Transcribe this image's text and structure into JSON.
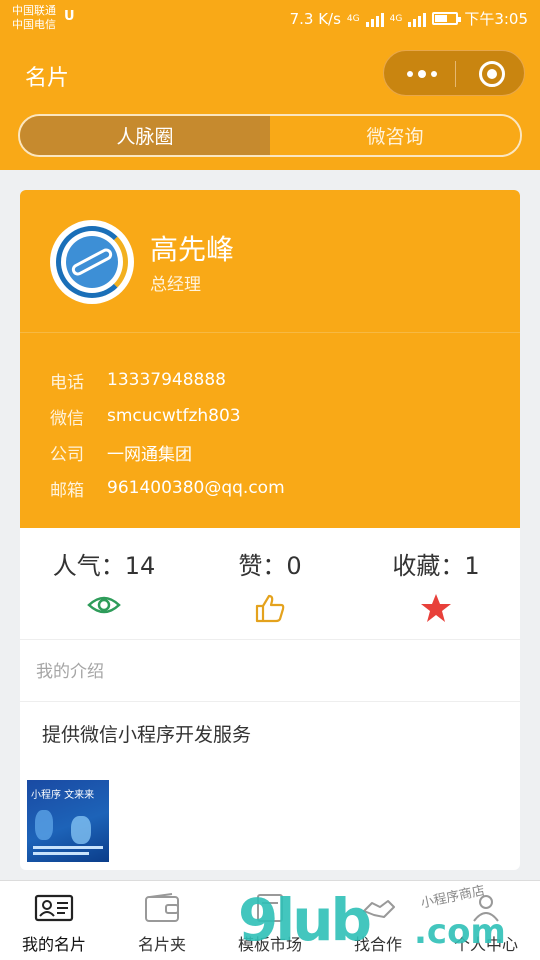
{
  "status_bar": {
    "carrier_1": "中国联通",
    "carrier_2": "中国电信",
    "speed": "7.3 K/s",
    "net_1": "4G",
    "net_2": "4G",
    "time": "下午3:05"
  },
  "nav": {
    "title": "名片",
    "more_icon": "more-dots-icon",
    "close_icon": "target-icon"
  },
  "segments": [
    {
      "label": "人脉圈",
      "selected": true
    },
    {
      "label": "微咨询",
      "selected": false
    }
  ],
  "card": {
    "name": "高先峰",
    "role": "总经理",
    "info": [
      {
        "key": "电话",
        "value": "13337948888"
      },
      {
        "key": "微信",
        "value": "smcucwtfzh803"
      },
      {
        "key": "公司",
        "value": "一网通集团"
      },
      {
        "key": "邮箱",
        "value": "961400380@qq.com"
      }
    ],
    "stats": [
      {
        "label": "人气：14",
        "icon": "eye-icon",
        "color": "#2e9c5a"
      },
      {
        "label": "赞：0",
        "icon": "thumbs-up-icon",
        "color": "#e4a21d"
      },
      {
        "label": "收藏：1",
        "icon": "star-icon",
        "color": "#e8403a"
      }
    ],
    "intro_heading": "我的介绍",
    "intro_text": "提供微信小程序开发服务",
    "thumb_text": "小程序 文来来"
  },
  "tabbar": {
    "items": [
      {
        "label": "我的名片",
        "icon": "id-card-icon"
      },
      {
        "label": "名片夹",
        "icon": "wallet-icon"
      },
      {
        "label": "模板市场",
        "icon": "template-icon"
      },
      {
        "label": "找合作",
        "icon": "handshake-icon"
      },
      {
        "label": "个人中心",
        "icon": "user-icon"
      }
    ]
  },
  "watermark": {
    "brand": "9lub",
    "suffix": ".com",
    "tagline": "小程序商店"
  },
  "colors": {
    "primary": "#f9a917",
    "segment_active": "#c68a2e"
  }
}
